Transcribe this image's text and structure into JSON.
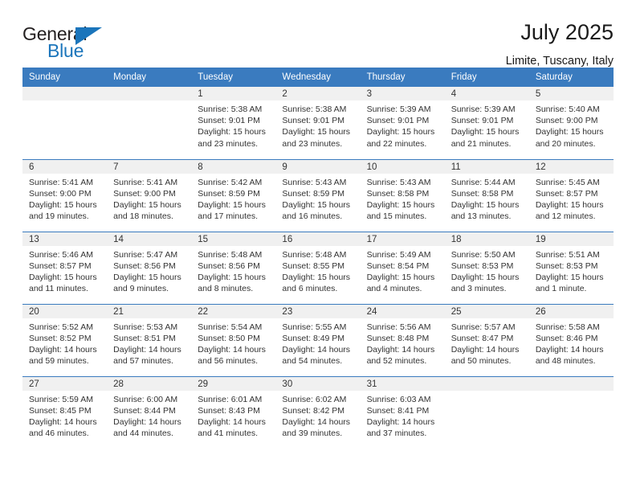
{
  "logo": {
    "word_top": "General",
    "word_bottom": "Blue",
    "triangle_icon": "triangle-icon",
    "accent_color": "#1b75bb"
  },
  "header": {
    "title": "July 2025",
    "subtitle": "Limite, Tuscany, Italy"
  },
  "theme": {
    "header_blue": "#3a7bbf",
    "daynum_band": "#f0f0f0",
    "text": "#333333"
  },
  "calendar": {
    "weekday_headers": [
      "Sunday",
      "Monday",
      "Tuesday",
      "Wednesday",
      "Thursday",
      "Friday",
      "Saturday"
    ],
    "weeks": [
      [
        {
          "day": "",
          "empty": true
        },
        {
          "day": "",
          "empty": true
        },
        {
          "day": "1",
          "sunrise": "Sunrise: 5:38 AM",
          "sunset": "Sunset: 9:01 PM",
          "daylight1": "Daylight: 15 hours",
          "daylight2": "and 23 minutes."
        },
        {
          "day": "2",
          "sunrise": "Sunrise: 5:38 AM",
          "sunset": "Sunset: 9:01 PM",
          "daylight1": "Daylight: 15 hours",
          "daylight2": "and 23 minutes."
        },
        {
          "day": "3",
          "sunrise": "Sunrise: 5:39 AM",
          "sunset": "Sunset: 9:01 PM",
          "daylight1": "Daylight: 15 hours",
          "daylight2": "and 22 minutes."
        },
        {
          "day": "4",
          "sunrise": "Sunrise: 5:39 AM",
          "sunset": "Sunset: 9:01 PM",
          "daylight1": "Daylight: 15 hours",
          "daylight2": "and 21 minutes."
        },
        {
          "day": "5",
          "sunrise": "Sunrise: 5:40 AM",
          "sunset": "Sunset: 9:00 PM",
          "daylight1": "Daylight: 15 hours",
          "daylight2": "and 20 minutes."
        }
      ],
      [
        {
          "day": "6",
          "sunrise": "Sunrise: 5:41 AM",
          "sunset": "Sunset: 9:00 PM",
          "daylight1": "Daylight: 15 hours",
          "daylight2": "and 19 minutes."
        },
        {
          "day": "7",
          "sunrise": "Sunrise: 5:41 AM",
          "sunset": "Sunset: 9:00 PM",
          "daylight1": "Daylight: 15 hours",
          "daylight2": "and 18 minutes."
        },
        {
          "day": "8",
          "sunrise": "Sunrise: 5:42 AM",
          "sunset": "Sunset: 8:59 PM",
          "daylight1": "Daylight: 15 hours",
          "daylight2": "and 17 minutes."
        },
        {
          "day": "9",
          "sunrise": "Sunrise: 5:43 AM",
          "sunset": "Sunset: 8:59 PM",
          "daylight1": "Daylight: 15 hours",
          "daylight2": "and 16 minutes."
        },
        {
          "day": "10",
          "sunrise": "Sunrise: 5:43 AM",
          "sunset": "Sunset: 8:58 PM",
          "daylight1": "Daylight: 15 hours",
          "daylight2": "and 15 minutes."
        },
        {
          "day": "11",
          "sunrise": "Sunrise: 5:44 AM",
          "sunset": "Sunset: 8:58 PM",
          "daylight1": "Daylight: 15 hours",
          "daylight2": "and 13 minutes."
        },
        {
          "day": "12",
          "sunrise": "Sunrise: 5:45 AM",
          "sunset": "Sunset: 8:57 PM",
          "daylight1": "Daylight: 15 hours",
          "daylight2": "and 12 minutes."
        }
      ],
      [
        {
          "day": "13",
          "sunrise": "Sunrise: 5:46 AM",
          "sunset": "Sunset: 8:57 PM",
          "daylight1": "Daylight: 15 hours",
          "daylight2": "and 11 minutes."
        },
        {
          "day": "14",
          "sunrise": "Sunrise: 5:47 AM",
          "sunset": "Sunset: 8:56 PM",
          "daylight1": "Daylight: 15 hours",
          "daylight2": "and 9 minutes."
        },
        {
          "day": "15",
          "sunrise": "Sunrise: 5:48 AM",
          "sunset": "Sunset: 8:56 PM",
          "daylight1": "Daylight: 15 hours",
          "daylight2": "and 8 minutes."
        },
        {
          "day": "16",
          "sunrise": "Sunrise: 5:48 AM",
          "sunset": "Sunset: 8:55 PM",
          "daylight1": "Daylight: 15 hours",
          "daylight2": "and 6 minutes."
        },
        {
          "day": "17",
          "sunrise": "Sunrise: 5:49 AM",
          "sunset": "Sunset: 8:54 PM",
          "daylight1": "Daylight: 15 hours",
          "daylight2": "and 4 minutes."
        },
        {
          "day": "18",
          "sunrise": "Sunrise: 5:50 AM",
          "sunset": "Sunset: 8:53 PM",
          "daylight1": "Daylight: 15 hours",
          "daylight2": "and 3 minutes."
        },
        {
          "day": "19",
          "sunrise": "Sunrise: 5:51 AM",
          "sunset": "Sunset: 8:53 PM",
          "daylight1": "Daylight: 15 hours",
          "daylight2": "and 1 minute."
        }
      ],
      [
        {
          "day": "20",
          "sunrise": "Sunrise: 5:52 AM",
          "sunset": "Sunset: 8:52 PM",
          "daylight1": "Daylight: 14 hours",
          "daylight2": "and 59 minutes."
        },
        {
          "day": "21",
          "sunrise": "Sunrise: 5:53 AM",
          "sunset": "Sunset: 8:51 PM",
          "daylight1": "Daylight: 14 hours",
          "daylight2": "and 57 minutes."
        },
        {
          "day": "22",
          "sunrise": "Sunrise: 5:54 AM",
          "sunset": "Sunset: 8:50 PM",
          "daylight1": "Daylight: 14 hours",
          "daylight2": "and 56 minutes."
        },
        {
          "day": "23",
          "sunrise": "Sunrise: 5:55 AM",
          "sunset": "Sunset: 8:49 PM",
          "daylight1": "Daylight: 14 hours",
          "daylight2": "and 54 minutes."
        },
        {
          "day": "24",
          "sunrise": "Sunrise: 5:56 AM",
          "sunset": "Sunset: 8:48 PM",
          "daylight1": "Daylight: 14 hours",
          "daylight2": "and 52 minutes."
        },
        {
          "day": "25",
          "sunrise": "Sunrise: 5:57 AM",
          "sunset": "Sunset: 8:47 PM",
          "daylight1": "Daylight: 14 hours",
          "daylight2": "and 50 minutes."
        },
        {
          "day": "26",
          "sunrise": "Sunrise: 5:58 AM",
          "sunset": "Sunset: 8:46 PM",
          "daylight1": "Daylight: 14 hours",
          "daylight2": "and 48 minutes."
        }
      ],
      [
        {
          "day": "27",
          "sunrise": "Sunrise: 5:59 AM",
          "sunset": "Sunset: 8:45 PM",
          "daylight1": "Daylight: 14 hours",
          "daylight2": "and 46 minutes."
        },
        {
          "day": "28",
          "sunrise": "Sunrise: 6:00 AM",
          "sunset": "Sunset: 8:44 PM",
          "daylight1": "Daylight: 14 hours",
          "daylight2": "and 44 minutes."
        },
        {
          "day": "29",
          "sunrise": "Sunrise: 6:01 AM",
          "sunset": "Sunset: 8:43 PM",
          "daylight1": "Daylight: 14 hours",
          "daylight2": "and 41 minutes."
        },
        {
          "day": "30",
          "sunrise": "Sunrise: 6:02 AM",
          "sunset": "Sunset: 8:42 PM",
          "daylight1": "Daylight: 14 hours",
          "daylight2": "and 39 minutes."
        },
        {
          "day": "31",
          "sunrise": "Sunrise: 6:03 AM",
          "sunset": "Sunset: 8:41 PM",
          "daylight1": "Daylight: 14 hours",
          "daylight2": "and 37 minutes."
        },
        {
          "day": "",
          "empty": true
        },
        {
          "day": "",
          "empty": true
        }
      ]
    ]
  }
}
